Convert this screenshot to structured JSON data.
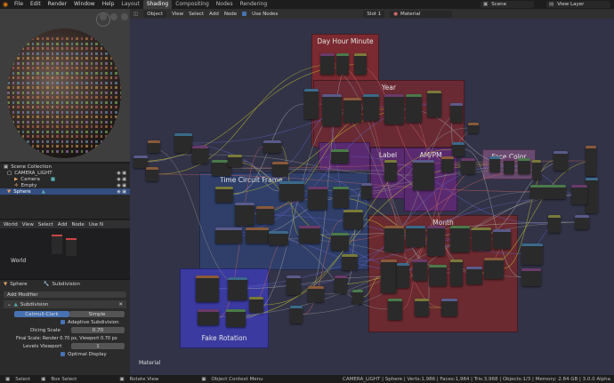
{
  "menu": {
    "items": [
      "File",
      "Edit",
      "Render",
      "Window",
      "Help"
    ],
    "workspaces": [
      "Layout",
      "Shading",
      "Compositing",
      "Nodes",
      "Rendering"
    ],
    "active_workspace": "Shading",
    "scene": "Scene",
    "view_layer": "View Layer"
  },
  "outliner": {
    "title": "Scene Collection",
    "rows": [
      "CAMERA_LIGHT",
      "Camera",
      "Empty",
      "Sphere"
    ]
  },
  "shader_mini": {
    "header": [
      "World",
      "View",
      "Select",
      "Add",
      "Node",
      "Use N"
    ],
    "label": "World"
  },
  "properties": {
    "object_name": "Sphere",
    "modifier_tab": "Subdivision",
    "add_modifier": "Add Modifier",
    "modifier_name": "Subdivision",
    "catmull": "Catmull-Clark",
    "simple": "Simple",
    "adaptive": "Adaptive Subdivision",
    "dicing_label": "Dicing Scale",
    "dicing_value": "0.70",
    "final_scale": "Final Scale: Render 0.70 px, Viewport 0.70 px",
    "levels_label": "Levels Viewport",
    "levels_value": "1",
    "optimal": "Optimal Display"
  },
  "node_editor": {
    "editor_mode": "Object",
    "menus": [
      "View",
      "Select",
      "Add",
      "Node"
    ],
    "use_nodes": "Use Nodes",
    "slot": "Slot 1",
    "material": "Material",
    "bottom_label": "Material",
    "frames": {
      "day_hour_minute": "Day Hour Minute",
      "year": "Year",
      "time_circuit": "Time Circuit Frame",
      "label": "Label",
      "ampm": "AM/PM",
      "face_color": "Face Color",
      "month": "Month",
      "fake_rotation": "Fake Rotation"
    }
  },
  "statusbar": {
    "select": "Select",
    "box_select": "Box Select",
    "rotate_view": "Rotate View",
    "context_menu": "Object Context Menu",
    "stats": "CAMERA_LIGHT | Sphere | Verts:1,986 | Faces:1,984 | Tris:3,968 | Objects:1/3 | Memory: 2.84 GB | 3.0.0 Alpha"
  },
  "colors": {
    "accent": "#e87d0d",
    "selection": "#334d80",
    "node_bg": "#323347",
    "frame_red": "#7a2a30",
    "frame_blue": "#2f3f6a",
    "frame_purple": "#5a2a70",
    "frame_violet": "#3a3aa0"
  }
}
